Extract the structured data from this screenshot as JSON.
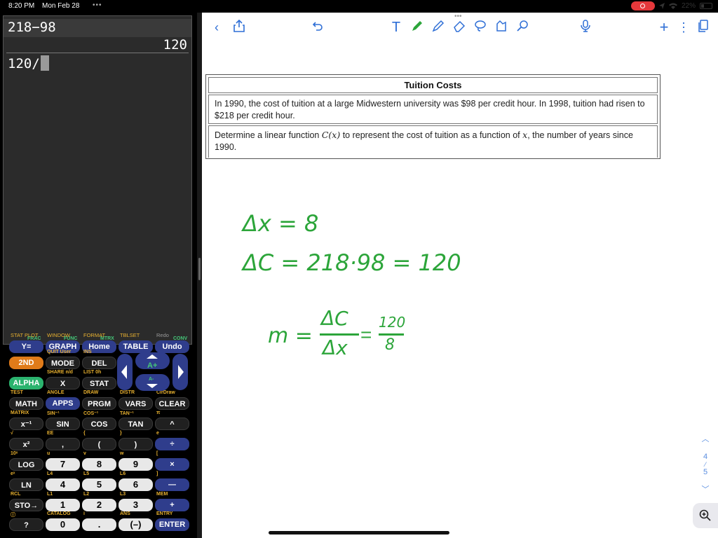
{
  "status": {
    "time": "8:20 PM",
    "date": "Mon Feb 28",
    "battery": "22%",
    "battery_level": 0.22
  },
  "calculator": {
    "screen": {
      "line1": "218−98",
      "result": "120",
      "line2": "120/"
    },
    "top_labels": [
      "STAT PLOT",
      "WINDOW",
      "FORMAT",
      "TBLSET",
      "Redo"
    ],
    "keys": {
      "y_eq": "Y=",
      "y_eq_sup": "FRAC",
      "graph": "GRAPH",
      "graph_sup": "FUNC",
      "home": "Home",
      "home_sup": "MTRX",
      "table": "TABLE",
      "table_sup": "",
      "undo": "Undo",
      "undo_sup": "CONV",
      "second": "2ND",
      "mode": "MODE",
      "mode_sup": "QUIT User",
      "del": "DEL",
      "del_sup": "INS",
      "alpha": "ALPHA",
      "alpha_sup": "",
      "x": "X",
      "x_sup": "SHARE n/d",
      "stat": "STAT",
      "stat_sup": "LIST  0h",
      "a_plus": "A+",
      "a_minus": "A-",
      "math": "MATH",
      "math_sup": "TEST",
      "apps": "APPS",
      "apps_sup": "ANGLE",
      "prgm": "PRGM",
      "prgm_sup": "DRAW",
      "vars": "VARS",
      "vars_sup": "DISTR",
      "clear": "CLEAR",
      "clear_sup": "CirDraw",
      "x_inv": "x⁻¹",
      "x_inv_sup": "MATRIX",
      "sin": "SIN",
      "sin_sup": "SIN⁻¹",
      "cos": "COS",
      "cos_sup": "COS⁻¹",
      "tan": "TAN",
      "tan_sup": "TAN⁻¹",
      "caret": "^",
      "caret_sup": "π",
      "x_sq": "x²",
      "x_sq_sup": "√",
      "comma": ",",
      "comma_sup": "EE",
      "lparen": "(",
      "lparen_sup": "{",
      "rparen": ")",
      "rparen_sup": "}",
      "divide": "÷",
      "divide_sup": "e",
      "log": "LOG",
      "log_sup": "10ˣ",
      "seven": "7",
      "seven_sup": "u",
      "eight": "8",
      "eight_sup": "v",
      "nine": "9",
      "nine_sup": "w",
      "times": "×",
      "times_sup": "[",
      "ln": "LN",
      "ln_sup": "eˣ",
      "four": "4",
      "four_sup": "L4",
      "five": "5",
      "five_sup": "L5",
      "six": "6",
      "six_sup": "L6",
      "minus": "—",
      "minus_sup": "]",
      "sto": "STO→",
      "sto_sup": "RCL",
      "one": "1",
      "one_sup": "L1",
      "two": "2",
      "two_sup": "L2",
      "three": "3",
      "three_sup": "L3",
      "plus": "+",
      "plus_sup": "MEM",
      "help": "?",
      "help_sup": "ⓘ",
      "zero": "0",
      "zero_sup": "CATALOG",
      "dot": ".",
      "dot_sup": "i",
      "neg": "(–)",
      "neg_sup": "ANS",
      "enter": "ENTER",
      "enter_sup": "ENTRY"
    }
  },
  "document": {
    "title": "Tuition Costs",
    "row1": "In 1990, the cost of tuition at a large Midwestern university was $98 per credit hour. In 1998, tuition had risen to $218 per credit hour.",
    "row2_a": "Determine a linear function ",
    "row2_fn": "C(x)",
    "row2_b": " to represent the cost of tuition as a function of ",
    "row2_x": "x",
    "row2_c": ", the number of years since 1990."
  },
  "handwriting": {
    "line1": "Δx = 8",
    "line2": "ΔC = 218·98 = 120",
    "m": "m =",
    "num1": "ΔC",
    "den1": "Δx",
    "eq": "=",
    "num2": "120",
    "den2": "8",
    "ink_color": "#2ca53a"
  },
  "page_nav": {
    "current": "4",
    "total": "5"
  },
  "colors": {
    "accent": "#2f6fd6",
    "ink": "#2ca53a"
  }
}
